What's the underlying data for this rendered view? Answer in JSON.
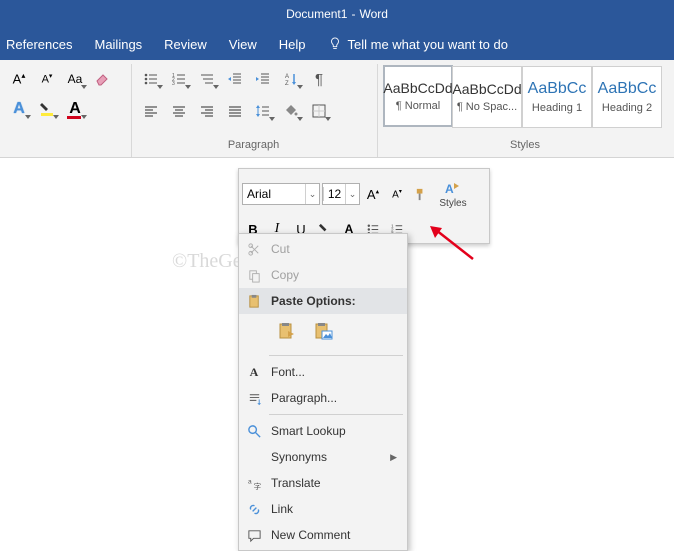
{
  "title": {
    "doc": "Document1",
    "app": "Word"
  },
  "tabs": {
    "references": "References",
    "mailings": "Mailings",
    "review": "Review",
    "view": "View",
    "help": "Help",
    "tellme": "Tell me what you want to do"
  },
  "ribbon": {
    "paragraph_label": "Paragraph",
    "styles_label": "Styles"
  },
  "styles": [
    {
      "sample": "AaBbCcDd",
      "caption": "¶ Normal",
      "selected": true
    },
    {
      "sample": "AaBbCcDd",
      "caption": "¶ No Spac..."
    },
    {
      "sample": "AaBbCc",
      "caption": "Heading 1",
      "heading": true
    },
    {
      "sample": "AaBbCc",
      "caption": "Heading 2",
      "heading": true
    }
  ],
  "mini": {
    "font": "Arial",
    "size": "12",
    "styles_label": "Styles"
  },
  "ctx": {
    "cut": "Cut",
    "copy": "Copy",
    "paste_hdr": "Paste Options:",
    "font": "Font...",
    "paragraph": "Paragraph...",
    "smart": "Smart Lookup",
    "syn": "Synonyms",
    "translate": "Translate",
    "link": "Link",
    "comment": "New Comment"
  },
  "watermark": "©TheGeekPage.com"
}
